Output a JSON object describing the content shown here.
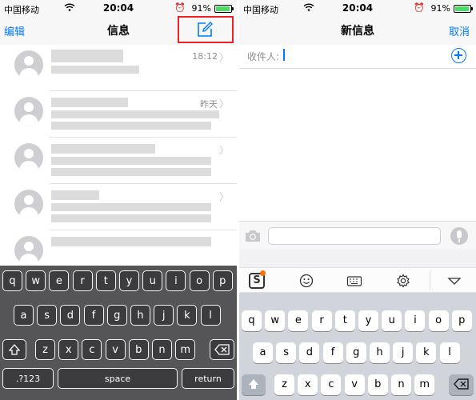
{
  "left": {
    "status": {
      "carrier": "中国移动",
      "time": "20:04",
      "battery": "91%",
      "battery_level": 0.91
    },
    "nav": {
      "edit_label": "编辑",
      "title": "信息"
    },
    "conversations": [
      {
        "date": "18:12"
      },
      {
        "date": "昨天"
      },
      {
        "date": ""
      },
      {
        "date": ""
      },
      {
        "date": ""
      }
    ],
    "keyboard": {
      "row1": [
        "q",
        "w",
        "e",
        "r",
        "t",
        "y",
        "u",
        "i",
        "o",
        "p"
      ],
      "row2": [
        "a",
        "s",
        "d",
        "f",
        "g",
        "h",
        "j",
        "k",
        "l"
      ],
      "row3": [
        "z",
        "x",
        "c",
        "v",
        "b",
        "n",
        "m"
      ],
      "numbers_label": ".?123",
      "space_label": "space",
      "return_label": "return"
    }
  },
  "right": {
    "status": {
      "carrier": "中国移动",
      "time": "20:04",
      "battery": "91%",
      "battery_level": 0.91
    },
    "nav": {
      "title": "新信息",
      "cancel_label": "取消"
    },
    "recipient_label": "收件人:",
    "sogou_label": "S",
    "keyboard": {
      "row1": [
        "q",
        "w",
        "e",
        "r",
        "t",
        "y",
        "u",
        "i",
        "o",
        "p"
      ],
      "row2": [
        "a",
        "s",
        "d",
        "f",
        "g",
        "h",
        "j",
        "k",
        "l"
      ],
      "row3": [
        "z",
        "x",
        "c",
        "v",
        "b",
        "n",
        "m"
      ]
    }
  },
  "colors": {
    "accent": "#007aff",
    "highlight": "#e22222",
    "battery_fill": "#4cd964",
    "sogou_dot": "#ff6c00"
  }
}
